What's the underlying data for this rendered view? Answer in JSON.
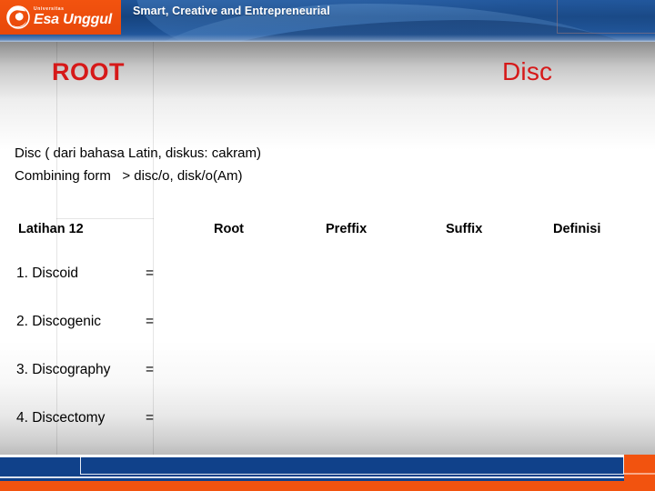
{
  "header": {
    "logo": {
      "superscript": "Universitas",
      "name": "Esa Unggul",
      "mark": "esa-unggul-logo-mark"
    },
    "tagline": "Smart, Creative and Entrepreneurial"
  },
  "slide": {
    "title_left": "ROOT",
    "title_right": "Disc",
    "paragraphs": [
      "Disc ( dari bahasa Latin, diskus: cakram)",
      "Combining form   > disc/o, disk/o(Am)"
    ],
    "table": {
      "headers": [
        "Latihan 12",
        "Root",
        "Preffix",
        "Suffix",
        "Definisi"
      ],
      "rows": [
        {
          "label": "1. Discoid",
          "equals": "=",
          "root": "",
          "preffix": "",
          "suffix": "",
          "definisi": ""
        },
        {
          "label": "2. Discogenic",
          "equals": "=",
          "root": "",
          "preffix": "",
          "suffix": "",
          "definisi": ""
        },
        {
          "label": "3. Discography",
          "equals": "=",
          "root": "",
          "preffix": "",
          "suffix": "",
          "definisi": ""
        },
        {
          "label": "4. Discectomy",
          "equals": "=",
          "root": "",
          "preffix": "",
          "suffix": "",
          "definisi": ""
        }
      ]
    }
  },
  "colors": {
    "title_red": "#d61919",
    "brand_orange": "#f2530f",
    "brand_blue": "#10418a",
    "header_blue": "#16447f"
  }
}
